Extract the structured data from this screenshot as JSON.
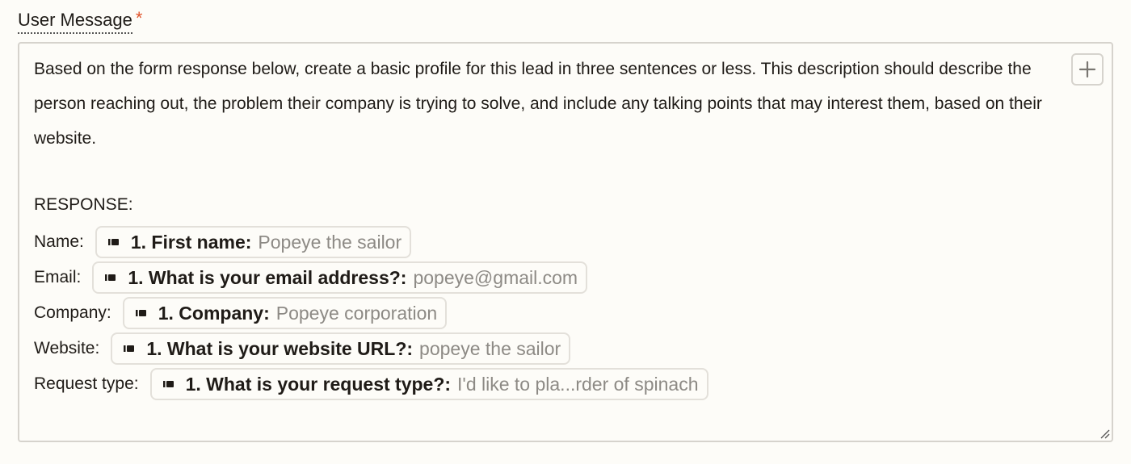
{
  "field": {
    "label": "User Message",
    "required_marker": "*"
  },
  "editor": {
    "prompt": "Based on the form response below, create a basic profile for this lead in three sentences or less. This description should describe the person reaching out, the problem their company is trying to solve, and include any talking points that may interest them, based on their website.",
    "response_heading": "RESPONSE:",
    "rows": [
      {
        "label": "Name:",
        "field": "1. First name:",
        "value": "Popeye the sailor"
      },
      {
        "label": "Email:",
        "field": "1. What is your email address?:",
        "value": "popeye@gmail.com"
      },
      {
        "label": "Company:",
        "field": "1. Company:",
        "value": "Popeye corporation"
      },
      {
        "label": "Website:",
        "field": "1. What is your website URL?:",
        "value": "popeye the sailor"
      },
      {
        "label": "Request type:",
        "field": "1. What is your request type?:",
        "value": "I'd like to pla...rder of spinach"
      }
    ],
    "add_button_icon": "plus-icon",
    "pill_icon": "form-app-icon",
    "resize_icon": "resize-handle-icon"
  },
  "colors": {
    "background": "#fdfcf8",
    "border": "#d6d3cd",
    "required": "#e0532a",
    "value_text": "#8d8a85"
  }
}
